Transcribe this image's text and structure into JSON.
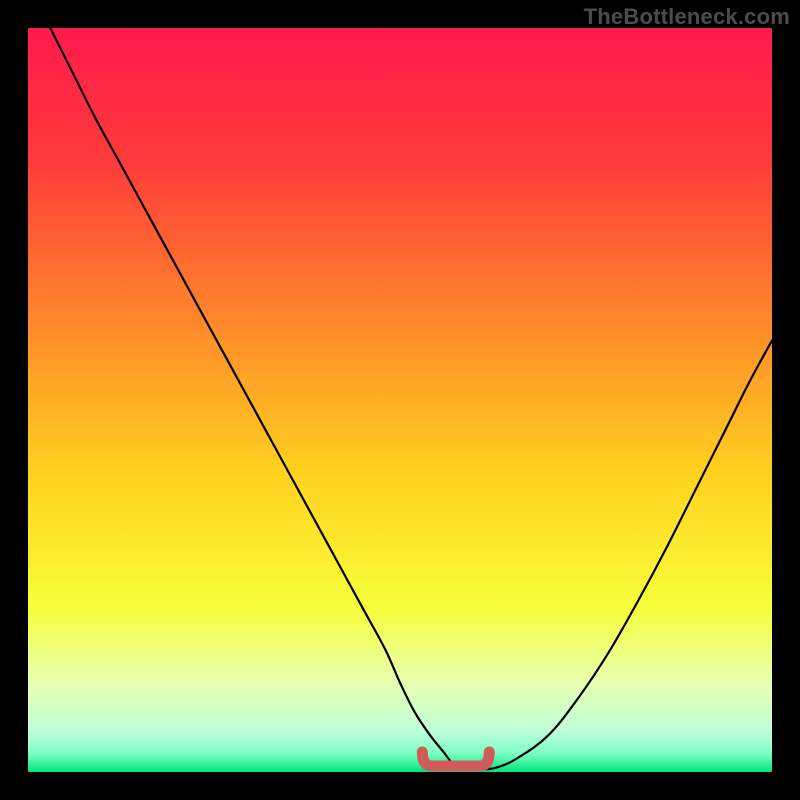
{
  "watermark": "TheBottleneck.com",
  "colors": {
    "frame_bg": "#000000",
    "watermark": "#4c4c4c",
    "curve": "#000000",
    "marker": "#cf5b5b",
    "gradient_stops": [
      {
        "offset": 0.0,
        "color": "#ff1a4d"
      },
      {
        "offset": 0.18,
        "color": "#ff3b3b"
      },
      {
        "offset": 0.4,
        "color": "#ff8a2a"
      },
      {
        "offset": 0.6,
        "color": "#ffd21f"
      },
      {
        "offset": 0.78,
        "color": "#f6ff3a"
      },
      {
        "offset": 0.88,
        "color": "#e7ffb0"
      },
      {
        "offset": 0.945,
        "color": "#bfffd8"
      },
      {
        "offset": 0.975,
        "color": "#7dffc4"
      },
      {
        "offset": 1.0,
        "color": "#00e47a"
      }
    ]
  },
  "chart_data": {
    "type": "line",
    "title": "",
    "xlabel": "",
    "ylabel": "",
    "xlim": [
      0,
      100
    ],
    "ylim": [
      0,
      100
    ],
    "grid": false,
    "legend": false,
    "series": [
      {
        "name": "bottleneck-curve",
        "x": [
          3,
          6,
          9,
          12,
          15,
          18,
          21,
          24,
          27,
          30,
          33,
          36,
          39,
          42,
          45,
          48,
          50,
          52,
          54,
          56,
          57,
          58,
          60,
          63,
          66,
          70,
          74,
          78,
          82,
          86,
          90,
          94,
          97,
          100
        ],
        "y": [
          100,
          94,
          88,
          82.5,
          77,
          71.5,
          66,
          60.5,
          55,
          49.5,
          44,
          38.5,
          33,
          27.5,
          22,
          16.5,
          12,
          8,
          5,
          2.5,
          1.2,
          0.6,
          0.3,
          0.6,
          2,
          5,
          10,
          16,
          23,
          30.5,
          38.5,
          46.5,
          52.5,
          58
        ]
      }
    ],
    "annotations": [
      {
        "name": "optimal-range-marker",
        "shape": "rounded-bracket",
        "x_range": [
          53,
          62
        ],
        "y": 0.8,
        "color": "#cf5b5b"
      }
    ]
  }
}
